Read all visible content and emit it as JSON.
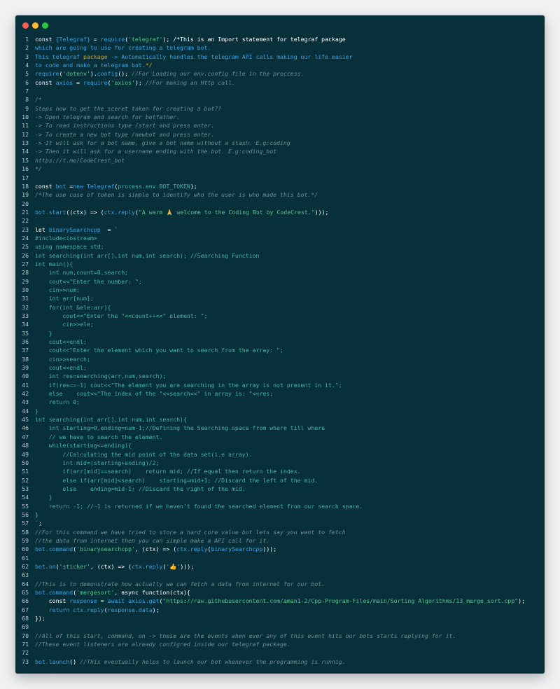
{
  "window": {
    "controls": [
      "close",
      "minimize",
      "maximize"
    ],
    "colors": {
      "background": "#08303b",
      "close": "#ff5f57",
      "minimize": "#febc2e",
      "maximize": "#28c840"
    }
  },
  "code_lines": [
    {
      "n": "1",
      "segs": [
        [
          "k",
          "const "
        ],
        [
          "b",
          "{Telegraf}"
        ],
        [
          "k",
          " = "
        ],
        [
          "b",
          "require"
        ],
        [
          "k",
          "("
        ],
        [
          "s",
          "'telegraf'"
        ],
        [
          "k",
          "); /*This is an Import statement for telegraf package"
        ]
      ]
    },
    {
      "n": "2",
      "segs": [
        [
          "b",
          "which are going to use for creating a telegram bot."
        ]
      ]
    },
    {
      "n": "3",
      "segs": [
        [
          "b",
          "This telegraf "
        ],
        [
          "y",
          "package"
        ],
        [
          "b",
          " -> Automatically handles the telegram API calls making our life easier"
        ]
      ]
    },
    {
      "n": "4",
      "segs": [
        [
          "b",
          "to code and make a telegram bot."
        ],
        [
          "y",
          "*/"
        ]
      ]
    },
    {
      "n": "5",
      "segs": [
        [
          "b",
          "require"
        ],
        [
          "k",
          "("
        ],
        [
          "s",
          "'dotenv'"
        ],
        [
          "k",
          ")."
        ],
        [
          "b",
          "config"
        ],
        [
          "k",
          "(); "
        ],
        [
          "c",
          "//For Loading our env.config file in the proccess."
        ]
      ]
    },
    {
      "n": "6",
      "segs": [
        [
          "k",
          "const "
        ],
        [
          "b",
          "axios"
        ],
        [
          "k",
          " = "
        ],
        [
          "b",
          "require"
        ],
        [
          "k",
          "("
        ],
        [
          "s",
          "'axios'"
        ],
        [
          "k",
          "); "
        ],
        [
          "c",
          "//For making an Http call."
        ]
      ]
    },
    {
      "n": "7",
      "segs": []
    },
    {
      "n": "8",
      "segs": [
        [
          "c",
          "/*"
        ]
      ]
    },
    {
      "n": "9",
      "segs": [
        [
          "c",
          "Steps how to get the sceret token for creating a bot??"
        ]
      ]
    },
    {
      "n": "10",
      "segs": [
        [
          "c",
          "-> Open telegram and search for botfather."
        ]
      ]
    },
    {
      "n": "11",
      "segs": [
        [
          "c",
          "-> To read instructions type /start and press enter."
        ]
      ]
    },
    {
      "n": "12",
      "segs": [
        [
          "c",
          "-> To create a new bot type /newbot and press enter."
        ]
      ]
    },
    {
      "n": "13",
      "segs": [
        [
          "c",
          "-> It will ask for a bot name, give a bot name without a slash. E.g:coding"
        ]
      ]
    },
    {
      "n": "14",
      "segs": [
        [
          "c",
          "-> Then it will ask for a username ending with the bot. E.g:coding_bot"
        ]
      ]
    },
    {
      "n": "15",
      "segs": [
        [
          "c",
          "https://t.me/CodeCrest_bot"
        ]
      ]
    },
    {
      "n": "16",
      "segs": [
        [
          "c",
          "*/"
        ]
      ]
    },
    {
      "n": "17",
      "segs": []
    },
    {
      "n": "18",
      "segs": [
        [
          "k",
          "const "
        ],
        [
          "b",
          "bot"
        ],
        [
          "k",
          " ="
        ],
        [
          "b",
          "new "
        ],
        [
          "b",
          "Telegraf"
        ],
        [
          "k",
          "("
        ],
        [
          "cp",
          "process.env.BOT_TOKEN"
        ],
        [
          "k",
          ");"
        ]
      ]
    },
    {
      "n": "19",
      "segs": [
        [
          "c",
          "/*The use case of token is simple to identify who the user is who made this bot.*/"
        ]
      ]
    },
    {
      "n": "20",
      "segs": []
    },
    {
      "n": "21",
      "segs": [
        [
          "b",
          "bot.start"
        ],
        [
          "k",
          "((ctx) => ("
        ],
        [
          "b",
          "ctx.reply"
        ],
        [
          "k",
          "("
        ],
        [
          "s",
          "\"A warm 🙏 welcome to the Coding Bot by CodeCrest.\""
        ],
        [
          "k",
          ")));"
        ]
      ]
    },
    {
      "n": "22",
      "segs": []
    },
    {
      "n": "23",
      "segs": [
        [
          "k",
          "let "
        ],
        [
          "b",
          "binarySearchcpp"
        ],
        [
          "k",
          "  = "
        ],
        [
          "s",
          "`"
        ]
      ]
    },
    {
      "n": "24",
      "segs": [
        [
          "cp",
          "#include<iostream>"
        ]
      ]
    },
    {
      "n": "25",
      "segs": [
        [
          "cp",
          "using namespace std;"
        ]
      ]
    },
    {
      "n": "26",
      "segs": [
        [
          "cp",
          "int searching(int arr[],int num,int search); //Searching Function"
        ]
      ]
    },
    {
      "n": "27",
      "segs": [
        [
          "cp",
          "int main(){"
        ]
      ]
    },
    {
      "n": "28",
      "segs": [
        [
          "cp",
          "    int num,count=0,search;"
        ]
      ]
    },
    {
      "n": "29",
      "segs": [
        [
          "cp",
          "    cout<<\"Enter the number: \";"
        ]
      ]
    },
    {
      "n": "30",
      "segs": [
        [
          "cp",
          "    cin>>num;"
        ]
      ]
    },
    {
      "n": "31",
      "segs": [
        [
          "cp",
          "    int arr[num];"
        ]
      ]
    },
    {
      "n": "32",
      "segs": [
        [
          "cp",
          "    for(int &ele:arr){"
        ]
      ]
    },
    {
      "n": "33",
      "segs": [
        [
          "cp",
          "        cout<<\"Enter the \"<<count++<<\" element: \";"
        ]
      ]
    },
    {
      "n": "34",
      "segs": [
        [
          "cp",
          "        cin>>ele;"
        ]
      ]
    },
    {
      "n": "35",
      "segs": [
        [
          "cp",
          "    }"
        ]
      ]
    },
    {
      "n": "36",
      "segs": [
        [
          "cp",
          "    cout<<endl;"
        ]
      ]
    },
    {
      "n": "37",
      "segs": [
        [
          "cp",
          "    cout<<\"Enter the element which you want to search from the array: \";"
        ]
      ]
    },
    {
      "n": "38",
      "segs": [
        [
          "cp",
          "    cin>>search;"
        ]
      ]
    },
    {
      "n": "39",
      "segs": [
        [
          "cp",
          "    cout<<endl;"
        ]
      ]
    },
    {
      "n": "40",
      "segs": [
        [
          "cp",
          "    int res=searching(arr,num,search);"
        ]
      ]
    },
    {
      "n": "41",
      "segs": [
        [
          "cp",
          "    if(res==-1) cout<<\"The element you are searching in the array is not present in it.\";"
        ]
      ]
    },
    {
      "n": "42",
      "segs": [
        [
          "cp",
          "    else    cout<<\"The index of the \"<<search<<\" in array is: \"<<res;"
        ]
      ]
    },
    {
      "n": "43",
      "segs": [
        [
          "cp",
          "    return 0;"
        ]
      ]
    },
    {
      "n": "44",
      "segs": [
        [
          "cp",
          "}"
        ]
      ]
    },
    {
      "n": "45",
      "segs": [
        [
          "cp",
          "int searching(int arr[],int num,int search){"
        ]
      ]
    },
    {
      "n": "46",
      "segs": [
        [
          "cp",
          "    int starting=0,ending=num-1;//Defining the Searching space from where till where"
        ]
      ]
    },
    {
      "n": "47",
      "segs": [
        [
          "cp",
          "    // we have to search the element."
        ]
      ]
    },
    {
      "n": "48",
      "segs": [
        [
          "cp",
          "    while(starting<=ending){"
        ]
      ]
    },
    {
      "n": "49",
      "segs": [
        [
          "cp",
          "        //Calculating the mid point of the data set(i.e array)."
        ]
      ]
    },
    {
      "n": "50",
      "segs": [
        [
          "cp",
          "        int mid=(starting+ending)/2;"
        ]
      ]
    },
    {
      "n": "51",
      "segs": [
        [
          "cp",
          "        if(arr[mid]==search)    return mid; //If equal then return the index."
        ]
      ]
    },
    {
      "n": "52",
      "segs": [
        [
          "cp",
          "        else if(arr[mid]<search)    starting=mid+1; //Discard the left of the mid."
        ]
      ]
    },
    {
      "n": "53",
      "segs": [
        [
          "cp",
          "        else    ending=mid-1; //Discard the right of the mid."
        ]
      ]
    },
    {
      "n": "54",
      "segs": [
        [
          "cp",
          "    }"
        ]
      ]
    },
    {
      "n": "55",
      "segs": [
        [
          "cp",
          "    return -1; //-1 is returned if we haven't found the searched element from our search space."
        ]
      ]
    },
    {
      "n": "56",
      "segs": [
        [
          "cp",
          "}"
        ]
      ]
    },
    {
      "n": "57",
      "segs": [
        [
          "s",
          "`"
        ],
        [
          "k",
          ";"
        ]
      ]
    },
    {
      "n": "58",
      "segs": [
        [
          "c",
          "//For this command we have tried to store a hard core value but lets say you want to fetch"
        ]
      ]
    },
    {
      "n": "59",
      "segs": [
        [
          "c",
          "//the data from internet then you can simple make a API call for it."
        ]
      ]
    },
    {
      "n": "60",
      "segs": [
        [
          "b",
          "bot.command"
        ],
        [
          "k",
          "("
        ],
        [
          "s",
          "'binarysearchcpp'"
        ],
        [
          "k",
          ", (ctx) => ("
        ],
        [
          "b",
          "ctx.reply"
        ],
        [
          "k",
          "("
        ],
        [
          "b",
          "binarySearchcpp"
        ],
        [
          "k",
          ")));"
        ]
      ]
    },
    {
      "n": "61",
      "segs": []
    },
    {
      "n": "62",
      "segs": [
        [
          "b",
          "bot.on"
        ],
        [
          "k",
          "("
        ],
        [
          "s",
          "'sticker'"
        ],
        [
          "k",
          ", (ctx) => ("
        ],
        [
          "b",
          "ctx.reply"
        ],
        [
          "k",
          "("
        ],
        [
          "s",
          "'👍'"
        ],
        [
          "k",
          ")));"
        ]
      ]
    },
    {
      "n": "63",
      "segs": []
    },
    {
      "n": "64",
      "segs": [
        [
          "c",
          "//This is to demonstrate how actually we can fetch a data from internet for our bot."
        ]
      ]
    },
    {
      "n": "65",
      "segs": [
        [
          "b",
          "bot.command"
        ],
        [
          "k",
          "("
        ],
        [
          "s",
          "'mergesort'"
        ],
        [
          "k",
          ", "
        ],
        [
          "k",
          "async function"
        ],
        [
          "k",
          "(ctx){"
        ]
      ]
    },
    {
      "n": "66",
      "segs": [
        [
          "k",
          "    const "
        ],
        [
          "b",
          "response"
        ],
        [
          "k",
          " = "
        ],
        [
          "b",
          "await "
        ],
        [
          "b",
          "axios.get"
        ],
        [
          "k",
          "("
        ],
        [
          "s",
          "\"https://raw.githubusercontent.com/aman1-2/Cpp-Program-Files/main/Sorting Algorithms/13_merge_sort.cpp\""
        ],
        [
          "k",
          ");"
        ]
      ]
    },
    {
      "n": "67",
      "segs": [
        [
          "b",
          "    return "
        ],
        [
          "b",
          "ctx.reply"
        ],
        [
          "k",
          "("
        ],
        [
          "b",
          "response.data"
        ],
        [
          "k",
          ");"
        ]
      ]
    },
    {
      "n": "68",
      "segs": [
        [
          "k",
          "});"
        ]
      ]
    },
    {
      "n": "69",
      "segs": []
    },
    {
      "n": "70",
      "segs": [
        [
          "c",
          "//All of this start, command, on -> these are the events when ever any of this event hits our bots starts replying for it."
        ]
      ]
    },
    {
      "n": "71",
      "segs": [
        [
          "c",
          "//These event listeners are already configred inside our telegraf package."
        ]
      ]
    },
    {
      "n": "72",
      "segs": []
    },
    {
      "n": "73",
      "segs": [
        [
          "b",
          "bot.launch"
        ],
        [
          "k",
          "() "
        ],
        [
          "c",
          "//This eventually helps to launch our bot whenever the programming is runnig."
        ]
      ]
    }
  ]
}
